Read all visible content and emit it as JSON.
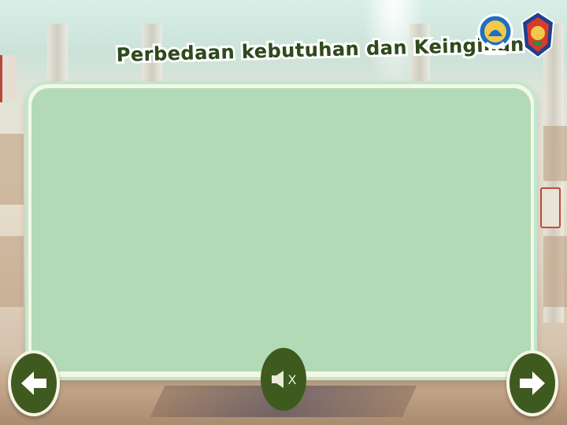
{
  "page": {
    "title": "Perbedaan kebutuhan dan Keinginan"
  },
  "logos": [
    {
      "icon": "tut-wuri-handayani-logo"
    },
    {
      "icon": "regional-government-seal-logo"
    }
  ],
  "controls": {
    "prev_icon": "arrow-left-icon",
    "next_icon": "arrow-right-icon",
    "sound_icon": "speaker-muted-icon",
    "sound_mark": "X"
  },
  "colors": {
    "button_green": "#3f5a1e",
    "board_green": "#b2dab7",
    "board_border": "#f4f8e3",
    "title_text": "#2f4a1c"
  }
}
